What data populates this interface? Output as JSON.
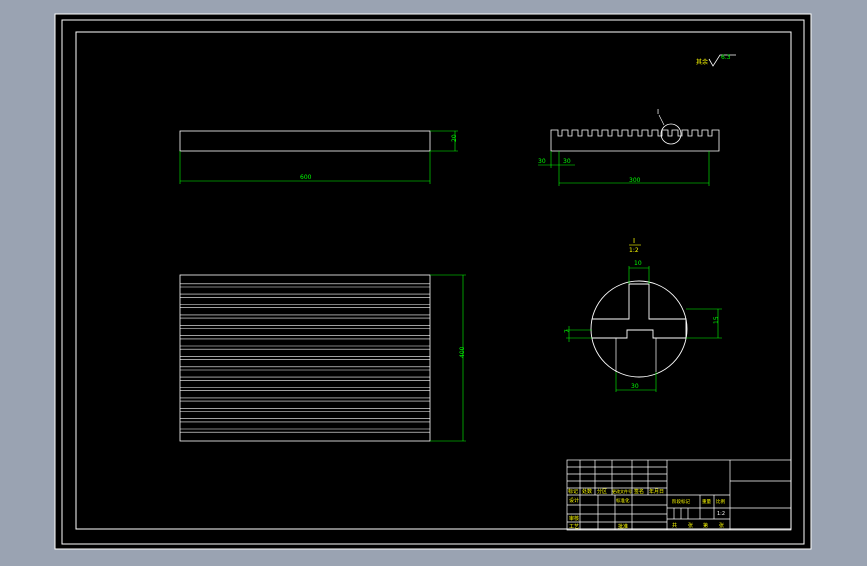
{
  "colors": {
    "background": "#9aa3b2",
    "canvas": "#000000",
    "linework": "#ffffff",
    "dimension": "#00ff00",
    "annotation_text": "#ffff00"
  },
  "surface_finish": {
    "label": "其余",
    "value": "6.3"
  },
  "front_view": {
    "length_dim": "600",
    "height_dim": "20"
  },
  "side_view": {
    "offset_dim_a": "30",
    "offset_dim_b": "30",
    "length_dim": "300",
    "detail_marker": "I"
  },
  "detail_view": {
    "title": "I",
    "scale": "1:2",
    "top_width_dim": "10",
    "right_height_dim": "15",
    "left_small_dim": "7",
    "bottom_width_dim": "30"
  },
  "top_view": {
    "height_dim": "400"
  },
  "title_block": {
    "labels": [
      "标记",
      "处数",
      "分区",
      "更改文件号",
      "签名",
      "年月日"
    ],
    "role_labels": [
      "设计",
      "审核",
      "工艺"
    ],
    "standardization": "标准化",
    "approval": "批准",
    "stage_mark": "阶段标记",
    "weight": "重量",
    "ratio": "比例",
    "ratio_value": "1:2",
    "sheet_labels": [
      "共",
      "张",
      "第",
      "张"
    ]
  }
}
